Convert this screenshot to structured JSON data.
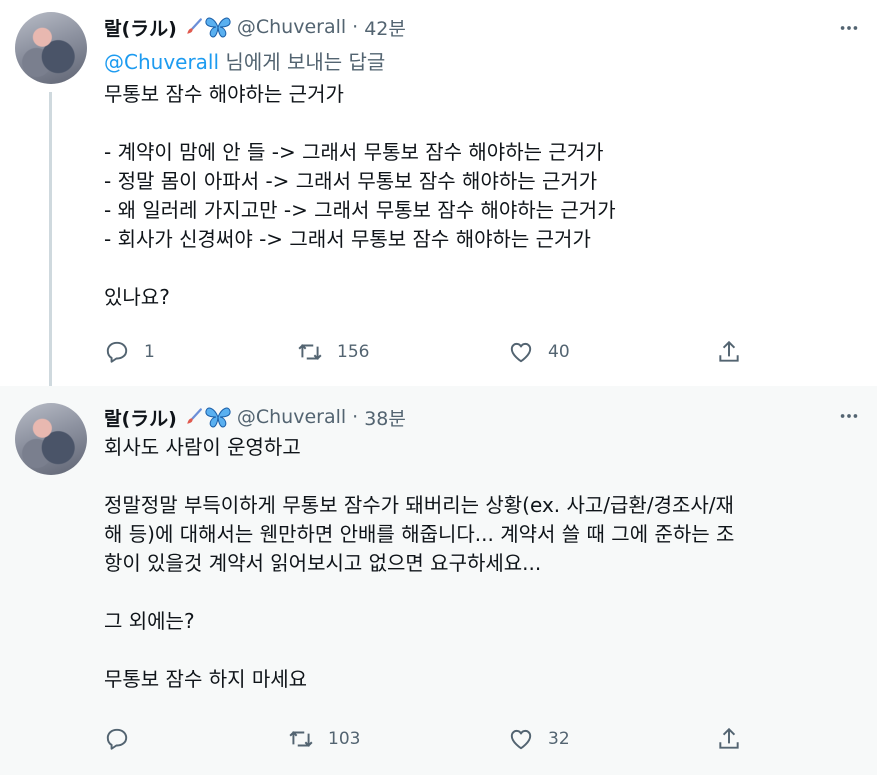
{
  "tweets": [
    {
      "display_name": "랄(ラル)",
      "handle": "@Chuverall",
      "separator": "·",
      "time": "42분",
      "reply_prefix": "@Chuverall",
      "reply_suffix": " 님에게 보내는 답글",
      "lines": [
        "무통보 잠수 해야하는 근거가",
        "",
        "- 계약이 맘에 안 들 -> 그래서 무통보 잠수 해야하는 근거가",
        "- 정말 몸이 아파서 -> 그래서 무통보 잠수 해야하는 근거가",
        "- 왜 일러레 가지고만 -> 그래서 무통보 잠수 해야하는 근거가",
        "- 회사가 신경써야 -> 그래서 무통보 잠수 해야하는 근거가",
        "",
        "있나요?"
      ],
      "reply_count": "1",
      "retweet_count": "156",
      "like_count": "40"
    },
    {
      "display_name": "랄(ラル)",
      "handle": "@Chuverall",
      "separator": "·",
      "time": "38분",
      "lines": [
        "회사도 사람이 운영하고",
        "",
        "정말정말 부득이하게 무통보 잠수가 돼버리는 상황(ex. 사고/급환/경조사/재",
        "해 등)에 대해서는 웬만하면 안배를 해줍니다... 계약서 쓸 때 그에 준하는 조",
        "항이 있을것 계약서 읽어보시고 없으면 요구하세요...",
        "",
        "그 외에는?",
        "",
        "무통보 잠수 하지 마세요"
      ],
      "reply_count": "",
      "retweet_count": "103",
      "like_count": "32"
    }
  ],
  "icons": {
    "emoji_1": "paintbrush-icon",
    "emoji_2": "butterfly-icon",
    "more": "more-dots-icon",
    "reply": "reply-icon",
    "retweet": "retweet-icon",
    "like": "heart-icon",
    "share": "share-icon"
  },
  "colors": {
    "link": "#1d9bf0",
    "secondary_text": "#536471",
    "thread_line": "#cfd9de",
    "hover_background": "#f7f9f9"
  }
}
